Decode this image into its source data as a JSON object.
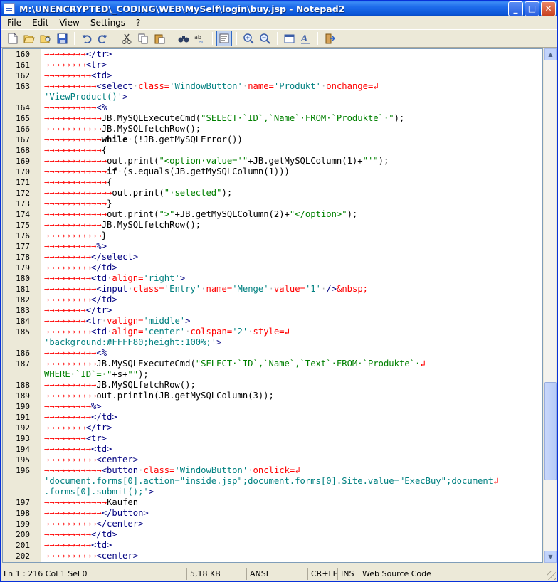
{
  "window": {
    "title": "M:\\UNENCRYPTED\\_CODING\\WEB\\MySelf\\login\\buy.jsp - Notepad2",
    "buttons": {
      "minimize": "_",
      "maximize": "□",
      "close": "✕"
    }
  },
  "menu": [
    {
      "label": "File",
      "accel": "F"
    },
    {
      "label": "Edit",
      "accel": "E"
    },
    {
      "label": "View",
      "accel": "V"
    },
    {
      "label": "Settings",
      "accel": "S"
    },
    {
      "label": "?",
      "accel": "?"
    }
  ],
  "toolbar": {
    "icons": [
      "new-file-icon",
      "open-file-icon",
      "browse-icon",
      "save-icon",
      "|",
      "undo-icon",
      "redo-icon",
      "|",
      "cut-icon",
      "copy-icon",
      "paste-icon",
      "|",
      "find-icon",
      "replace-icon",
      "|",
      "word-wrap-icon",
      "|",
      "zoom-in-icon",
      "zoom-out-icon",
      "|",
      "scheme-icon",
      "font-icon",
      "|",
      "exit-icon"
    ]
  },
  "editor": {
    "lines": [
      {
        "n": "160",
        "code": [
          [
            "ws",
            "→→→→→→→→"
          ],
          [
            "tag",
            "</tr>"
          ]
        ]
      },
      {
        "n": "161",
        "code": [
          [
            "ws",
            "→→→→→→→→"
          ],
          [
            "tag",
            "<tr>"
          ]
        ]
      },
      {
        "n": "162",
        "code": [
          [
            "ws",
            "→→→→→→→→→"
          ],
          [
            "tag",
            "<td>"
          ]
        ]
      },
      {
        "n": "163",
        "code": [
          [
            "ws",
            "→→→→→→→→→→"
          ],
          [
            "tag",
            "<select"
          ],
          [
            "dot",
            "·"
          ],
          [
            "attr",
            "class="
          ],
          [
            "val",
            "'WindowButton'"
          ],
          [
            "dot",
            "·"
          ],
          [
            "attr",
            "name="
          ],
          [
            "val",
            "'Produkt'"
          ],
          [
            "dot",
            "·"
          ],
          [
            "attr",
            "onchange="
          ],
          [
            "ws",
            "↲"
          ]
        ]
      },
      {
        "n": "",
        "code": [
          [
            "val",
            "'ViewProduct()'"
          ],
          [
            "tag",
            ">"
          ]
        ]
      },
      {
        "n": "164",
        "code": [
          [
            "ws",
            "→→→→→→→→→→"
          ],
          [
            "tag",
            "<%"
          ]
        ]
      },
      {
        "n": "165",
        "code": [
          [
            "ws",
            "→→→→→→→→→→→"
          ],
          [
            "",
            "JB.MySQLExecuteCmd("
          ],
          [
            "str",
            "\"SELECT·`ID`,`Name`·FROM·`Produkte`·\""
          ],
          [
            "",
            "); "
          ]
        ]
      },
      {
        "n": "166",
        "code": [
          [
            "ws",
            "→→→→→→→→→→→"
          ],
          [
            "",
            "JB.MySQLfetchRow();"
          ]
        ]
      },
      {
        "n": "167",
        "code": [
          [
            "ws",
            "→→→→→→→→→→→"
          ],
          [
            "kw",
            "while"
          ],
          [
            "dot",
            "·"
          ],
          [
            "",
            "(!JB.getMySQLError())"
          ]
        ]
      },
      {
        "n": "168",
        "code": [
          [
            "ws",
            "→→→→→→→→→→→"
          ],
          [
            "",
            "{"
          ]
        ]
      },
      {
        "n": "169",
        "code": [
          [
            "ws",
            "→→→→→→→→→→→→"
          ],
          [
            "",
            "out.print("
          ],
          [
            "str",
            "\"<option·value='\""
          ],
          [
            "",
            "+JB.getMySQLColumn(1)+"
          ],
          [
            "str",
            "\"'\""
          ],
          [
            "",
            ");"
          ]
        ]
      },
      {
        "n": "170",
        "code": [
          [
            "ws",
            "→→→→→→→→→→→→"
          ],
          [
            "kw",
            "if"
          ],
          [
            "dot",
            "·"
          ],
          [
            "",
            "(s.equals(JB.getMySQLColumn(1)))"
          ]
        ]
      },
      {
        "n": "171",
        "code": [
          [
            "ws",
            "→→→→→→→→→→→→"
          ],
          [
            "",
            "{"
          ]
        ]
      },
      {
        "n": "172",
        "code": [
          [
            "ws",
            "→→→→→→→→→→→→→"
          ],
          [
            "",
            "out.print("
          ],
          [
            "str",
            "\"·selected\""
          ],
          [
            "",
            ");"
          ]
        ]
      },
      {
        "n": "173",
        "code": [
          [
            "ws",
            "→→→→→→→→→→→→"
          ],
          [
            "",
            "}"
          ]
        ]
      },
      {
        "n": "174",
        "code": [
          [
            "ws",
            "→→→→→→→→→→→→"
          ],
          [
            "",
            "out.print("
          ],
          [
            "str",
            "\">\""
          ],
          [
            "",
            "+JB.getMySQLColumn(2)+"
          ],
          [
            "str",
            "\"</option>\""
          ],
          [
            "",
            ");"
          ]
        ]
      },
      {
        "n": "175",
        "code": [
          [
            "ws",
            "→→→→→→→→→→→"
          ],
          [
            "",
            "JB.MySQLfetchRow();"
          ]
        ]
      },
      {
        "n": "176",
        "code": [
          [
            "ws",
            "→→→→→→→→→→→"
          ],
          [
            "",
            "}"
          ]
        ]
      },
      {
        "n": "177",
        "code": [
          [
            "ws",
            "→→→→→→→→→→"
          ],
          [
            "tag",
            "%>"
          ]
        ]
      },
      {
        "n": "178",
        "code": [
          [
            "ws",
            "→→→→→→→→→"
          ],
          [
            "tag",
            "</select>"
          ]
        ]
      },
      {
        "n": "179",
        "code": [
          [
            "ws",
            "→→→→→→→→→"
          ],
          [
            "tag",
            "</td>"
          ]
        ]
      },
      {
        "n": "180",
        "code": [
          [
            "ws",
            "→→→→→→→→→"
          ],
          [
            "tag",
            "<td"
          ],
          [
            "dot",
            "·"
          ],
          [
            "attr",
            "align="
          ],
          [
            "val",
            "'right'"
          ],
          [
            "tag",
            ">"
          ]
        ]
      },
      {
        "n": "181",
        "code": [
          [
            "ws",
            "→→→→→→→→→→"
          ],
          [
            "tag",
            "<input"
          ],
          [
            "dot",
            "·"
          ],
          [
            "attr",
            "class="
          ],
          [
            "val",
            "'Entry'"
          ],
          [
            "dot",
            "·"
          ],
          [
            "attr",
            "name="
          ],
          [
            "val",
            "'Menge'"
          ],
          [
            "dot",
            "·"
          ],
          [
            "attr",
            "value="
          ],
          [
            "val",
            "'1'"
          ],
          [
            "dot",
            "·"
          ],
          [
            "tag",
            "/>"
          ],
          [
            "attr",
            "&nbsp;"
          ]
        ]
      },
      {
        "n": "182",
        "code": [
          [
            "ws",
            "→→→→→→→→→"
          ],
          [
            "tag",
            "</td>"
          ]
        ]
      },
      {
        "n": "183",
        "code": [
          [
            "ws",
            "→→→→→→→→"
          ],
          [
            "tag",
            "</tr>"
          ]
        ]
      },
      {
        "n": "184",
        "code": [
          [
            "ws",
            "→→→→→→→→"
          ],
          [
            "tag",
            "<tr"
          ],
          [
            "dot",
            "·"
          ],
          [
            "attr",
            "valign="
          ],
          [
            "val",
            "'middle'"
          ],
          [
            "tag",
            ">"
          ]
        ]
      },
      {
        "n": "185",
        "code": [
          [
            "ws",
            "→→→→→→→→→"
          ],
          [
            "tag",
            "<td"
          ],
          [
            "dot",
            "·"
          ],
          [
            "attr",
            "align="
          ],
          [
            "val",
            "'center'"
          ],
          [
            "dot",
            "·"
          ],
          [
            "attr",
            "colspan="
          ],
          [
            "val",
            "'2'"
          ],
          [
            "dot",
            "·"
          ],
          [
            "attr",
            "style="
          ],
          [
            "ws",
            "↲"
          ]
        ]
      },
      {
        "n": "",
        "code": [
          [
            "val",
            "'background:#FFFF80;height:100%;'"
          ],
          [
            "tag",
            ">"
          ]
        ]
      },
      {
        "n": "186",
        "code": [
          [
            "ws",
            "→→→→→→→→→→"
          ],
          [
            "tag",
            "<%"
          ]
        ]
      },
      {
        "n": "187",
        "code": [
          [
            "ws",
            "→→→→→→→→→→"
          ],
          [
            "",
            "JB.MySQLExecuteCmd("
          ],
          [
            "str",
            "\"SELECT·`ID`,`Name`,`Text`·FROM·`Produkte`·"
          ],
          [
            "ws",
            "↲"
          ]
        ]
      },
      {
        "n": "",
        "code": [
          [
            "str",
            "WHERE·`ID`=·\""
          ],
          [
            "",
            "+s+"
          ],
          [
            "str",
            "\"\""
          ],
          [
            "",
            ");"
          ]
        ]
      },
      {
        "n": "188",
        "code": [
          [
            "ws",
            "→→→→→→→→→→"
          ],
          [
            "",
            "JB.MySQLfetchRow();"
          ]
        ]
      },
      {
        "n": "189",
        "code": [
          [
            "ws",
            "→→→→→→→→→→"
          ],
          [
            "",
            "out.println(JB.getMySQLColumn(3));"
          ]
        ]
      },
      {
        "n": "190",
        "code": [
          [
            "ws",
            "→→→→→→→→→"
          ],
          [
            "tag",
            "%>"
          ]
        ]
      },
      {
        "n": "191",
        "code": [
          [
            "ws",
            "→→→→→→→→→"
          ],
          [
            "tag",
            "</td>"
          ]
        ]
      },
      {
        "n": "192",
        "code": [
          [
            "ws",
            "→→→→→→→→"
          ],
          [
            "tag",
            "</tr>"
          ]
        ]
      },
      {
        "n": "193",
        "code": [
          [
            "ws",
            "→→→→→→→→"
          ],
          [
            "tag",
            "<tr>"
          ]
        ]
      },
      {
        "n": "194",
        "code": [
          [
            "ws",
            "→→→→→→→→→"
          ],
          [
            "tag",
            "<td>"
          ]
        ]
      },
      {
        "n": "195",
        "code": [
          [
            "ws",
            "→→→→→→→→→→"
          ],
          [
            "tag",
            "<center>"
          ]
        ]
      },
      {
        "n": "196",
        "code": [
          [
            "ws",
            "→→→→→→→→→→→"
          ],
          [
            "tag",
            "<button"
          ],
          [
            "dot",
            "·"
          ],
          [
            "attr",
            "class="
          ],
          [
            "val",
            "'WindowButton'"
          ],
          [
            "dot",
            "·"
          ],
          [
            "attr",
            "onclick="
          ],
          [
            "ws",
            "↲"
          ]
        ]
      },
      {
        "n": "",
        "code": [
          [
            "val",
            "'document.forms[0].action=\"inside.jsp\";document.forms[0].Site.value=\"ExecBuy\";document"
          ],
          [
            "ws",
            "↲"
          ]
        ]
      },
      {
        "n": "",
        "code": [
          [
            "val",
            ".forms[0].submit();'"
          ],
          [
            "tag",
            ">"
          ]
        ]
      },
      {
        "n": "197",
        "code": [
          [
            "ws",
            "→→→→→→→→→→→→"
          ],
          [
            "",
            "Kaufen"
          ]
        ]
      },
      {
        "n": "198",
        "code": [
          [
            "ws",
            "→→→→→→→→→→→"
          ],
          [
            "tag",
            "</button>"
          ]
        ]
      },
      {
        "n": "199",
        "code": [
          [
            "ws",
            "→→→→→→→→→→"
          ],
          [
            "tag",
            "</center>"
          ]
        ]
      },
      {
        "n": "200",
        "code": [
          [
            "ws",
            "→→→→→→→→→"
          ],
          [
            "tag",
            "</td>"
          ]
        ]
      },
      {
        "n": "201",
        "code": [
          [
            "ws",
            "→→→→→→→→→"
          ],
          [
            "tag",
            "<td>"
          ]
        ]
      },
      {
        "n": "202",
        "code": [
          [
            "ws",
            "→→→→→→→→→→"
          ],
          [
            "tag",
            "<center>"
          ]
        ]
      }
    ]
  },
  "status": {
    "position": "Ln 1 : 216   Col 1   Sel 0",
    "size": "5,18 KB",
    "encoding": "ANSI",
    "line_endings": "CR+LF",
    "mode": "INS",
    "scheme": "Web Source Code"
  },
  "scrollbar": {
    "position_fraction": 0.82,
    "visible_fraction": 0.2
  }
}
